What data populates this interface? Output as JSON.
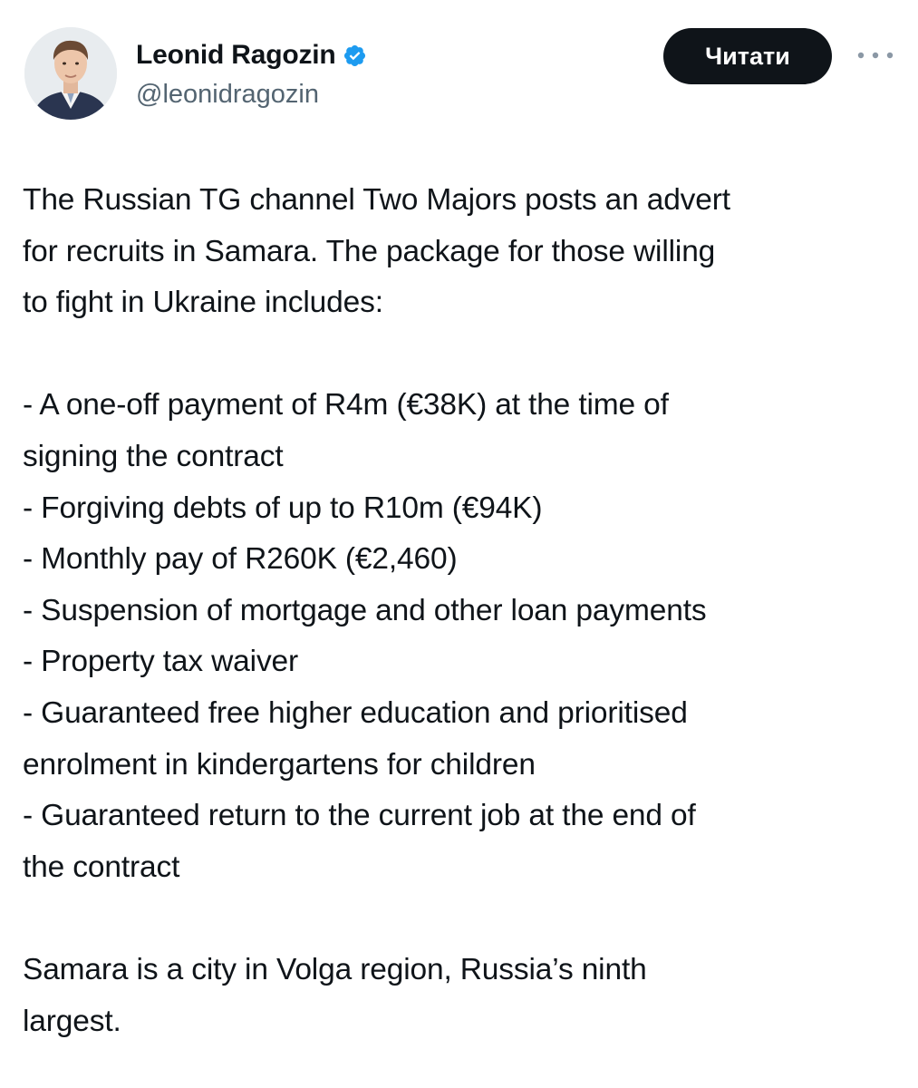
{
  "author": {
    "name": "Leonid Ragozin",
    "handle": "@leonidragozin",
    "verified": true
  },
  "actions": {
    "follow_label": "Читати",
    "more_icon": "ellipsis-icon"
  },
  "colors": {
    "text": "#0f1419",
    "secondary": "#536471",
    "verified_badge": "#1d9bf0",
    "button_bg": "#0f1419"
  },
  "tweet": {
    "intro": [
      "The Russian TG channel Two Majors posts an advert",
      "for recruits in Samara. The package for those willing",
      "to fight in Ukraine includes:"
    ],
    "items": [
      [
        "- A one-off payment of R4m (€38K) at the time of",
        "signing the contract"
      ],
      [
        "- Forgiving debts of up to R10m (€94K)"
      ],
      [
        "- Monthly pay of R260K (€2,460)"
      ],
      [
        "- Suspension of mortgage and other loan payments"
      ],
      [
        "- Property tax waiver"
      ],
      [
        "- Guaranteed free higher education and prioritised",
        "enrolment in kindergartens for children"
      ],
      [
        "- Guaranteed return to the current job at the end of",
        "the contract"
      ]
    ],
    "outro": [
      "Samara is a city in Volga region, Russia’s ninth",
      "largest."
    ]
  }
}
